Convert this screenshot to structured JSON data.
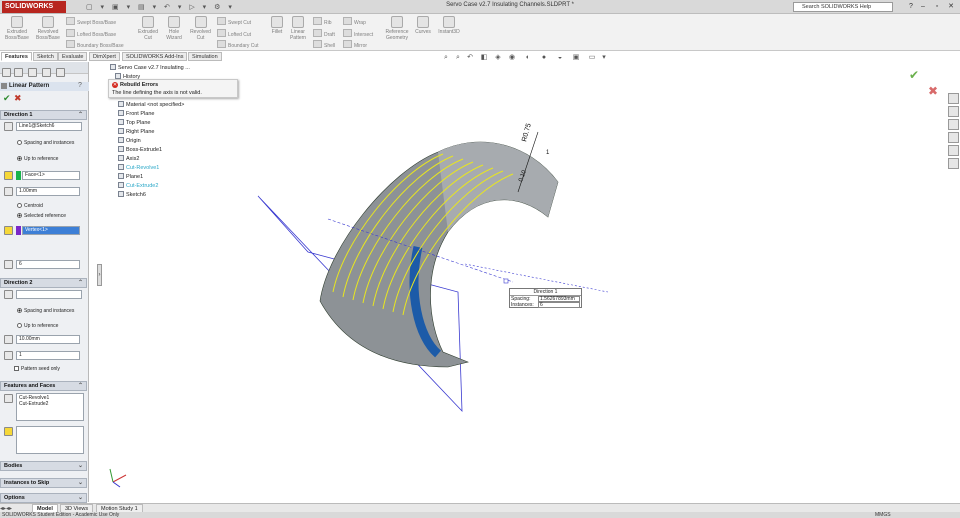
{
  "app": {
    "logo": "SOLIDWORKS",
    "document_title": "Servo Case v2.7 Insulating Channels.SLDPRT *",
    "search_placeholder": "Search SOLIDWORKS Help"
  },
  "ribbon": {
    "extruded_boss": "Extruded Boss/Base",
    "revolved_boss": "Revolved Boss/Base",
    "swept_boss": "Swept Boss/Base",
    "lofted_boss": "Lofted Boss/Base",
    "boundary_boss": "Boundary Boss/Base",
    "extruded_cut": "Extruded Cut",
    "hole_wizard": "Hole Wizard",
    "revolved_cut": "Revolved Cut",
    "swept_cut": "Swept Cut",
    "lofted_cut": "Lofted Cut",
    "boundary_cut": "Boundary Cut",
    "fillet": "Fillet",
    "linear_pattern": "Linear Pattern",
    "rib": "Rib",
    "draft": "Draft",
    "shell": "Shell",
    "wrap": "Wrap",
    "intersect": "Intersect",
    "mirror": "Mirror",
    "reference_geometry": "Reference Geometry",
    "curves": "Curves",
    "instant3d": "Instant3D"
  },
  "tabs": [
    "Features",
    "Sketch",
    "Evaluate",
    "DimXpert",
    "SOLIDWORKS Add-Ins",
    "Simulation"
  ],
  "panel": {
    "title": "Linear Pattern",
    "direction1": {
      "header": "Direction 1",
      "direction_ref": "Line1@Sketch6",
      "spacing_option": "Spacing and instances",
      "upto_option": "Up to reference",
      "reference": "Face<1>",
      "offset": "1.00mm",
      "centroid_option": "Centroid",
      "selected_ref_option": "Selected reference",
      "vertex": "Vertex<1>",
      "instances": "6"
    },
    "direction2": {
      "header": "Direction 2",
      "spacing_option": "Spacing and instances",
      "upto_option": "Up to reference",
      "spacing": "10.00mm",
      "instances": "1",
      "seed_only": "Pattern seed only"
    },
    "features": {
      "header": "Features and Faces",
      "items": [
        "Cut-Revolve1",
        "Cut-Extrude2"
      ]
    },
    "bodies": "Bodies",
    "instances_skip": "Instances to Skip",
    "options": "Options"
  },
  "tree": {
    "root": "Servo Case v2.7 Insulating ...",
    "history": "History",
    "items": [
      "Material <not specified>",
      "Front Plane",
      "Top Plane",
      "Right Plane",
      "Origin",
      "Boss-Extrude1",
      "Axis2",
      "Cut-Revolve1",
      "Plane1",
      "Cut-Extrude2",
      "Sketch6"
    ]
  },
  "error": {
    "title": "Rebuild Errors",
    "message": "The line defining the axis is not valid."
  },
  "callout": {
    "header": "Direction 1",
    "spacing_label": "Spacing:",
    "spacing_value": "1.56267893mm",
    "instances_label": "Instances:",
    "instances_value": "6"
  },
  "dimensions": {
    "radius": "R0.75",
    "width": "1",
    "small": "0.10"
  },
  "bottom_tabs": [
    "Model",
    "3D Views",
    "Motion Study 1"
  ],
  "status": {
    "left": "SOLIDWORKS Student Edition - Academic Use Only",
    "units": "MMGS"
  },
  "colors": {
    "accent_blue": "#2f6fc0",
    "part_grey": "#8d9296",
    "yellow_edges": "#e8e620",
    "error_red": "#d3271d"
  }
}
